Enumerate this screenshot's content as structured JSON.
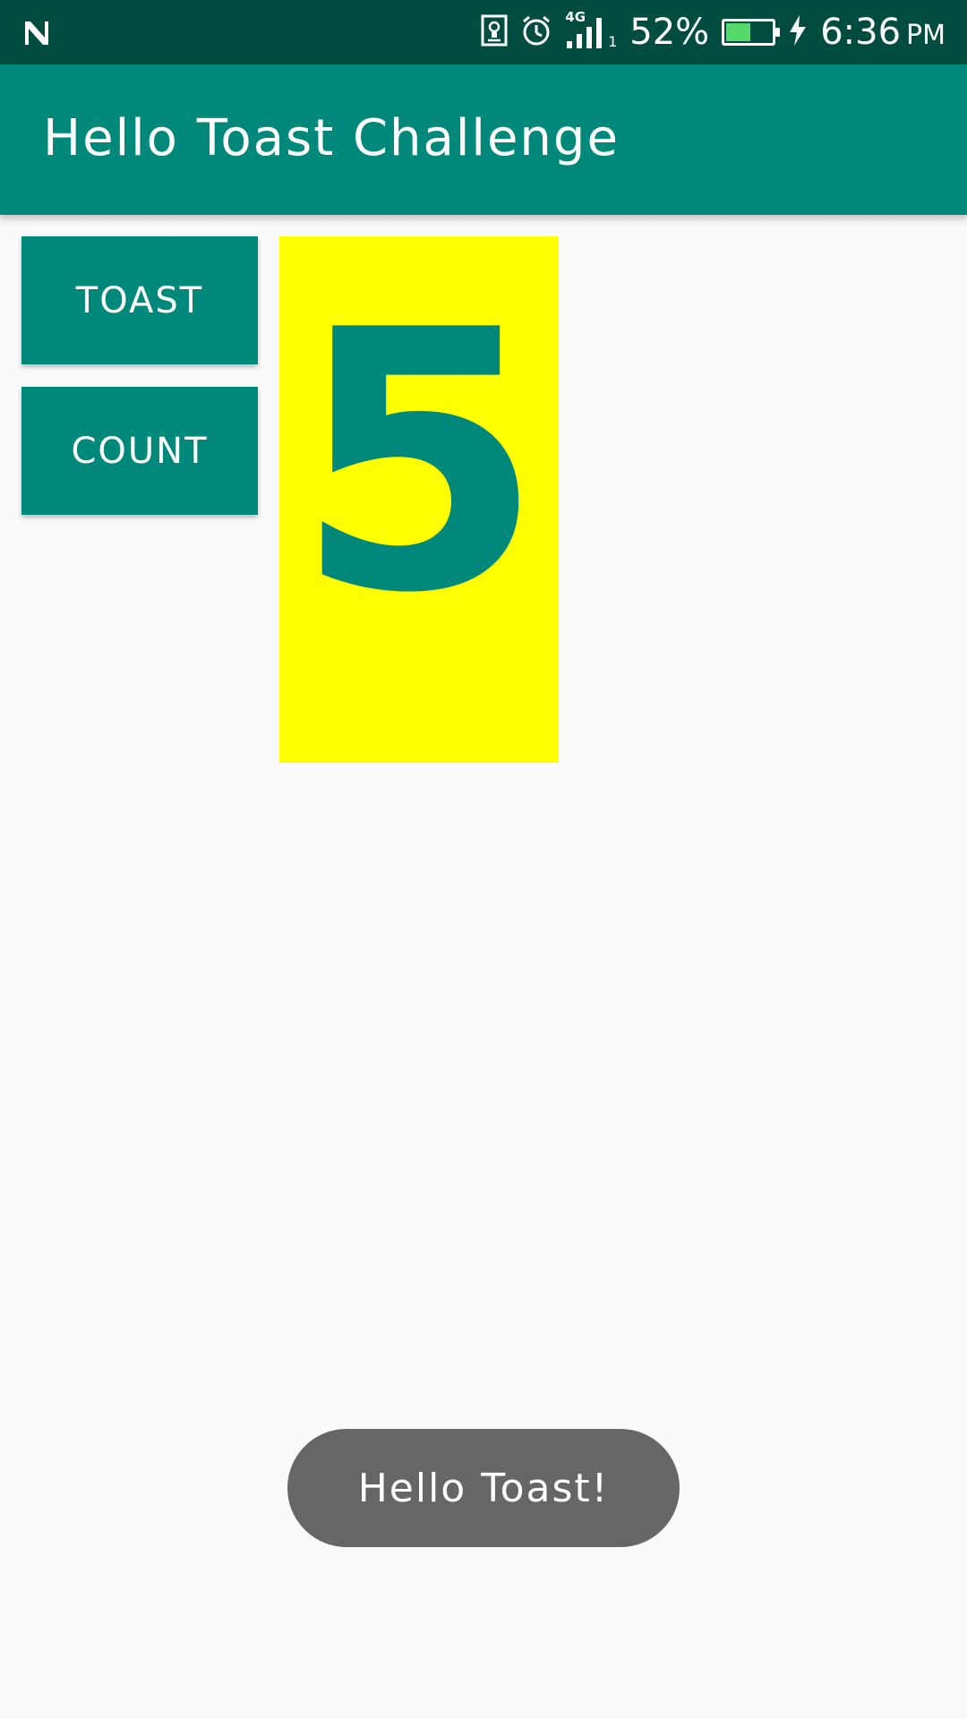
{
  "status_bar": {
    "battery_percent": "52%",
    "battery_level": 0.52,
    "time": "6:36",
    "time_suffix": "PM",
    "network": "4G",
    "sim_slot": "1",
    "icons": [
      "notification-n-icon",
      "screenshot-icon",
      "alarm-icon",
      "signal-icon",
      "battery-icon",
      "charging-icon"
    ]
  },
  "app_bar": {
    "title": "Hello Toast Challenge"
  },
  "buttons": {
    "toast_label": "TOAST",
    "count_label": "COUNT"
  },
  "counter": {
    "value": "5"
  },
  "toast": {
    "message": "Hello Toast!"
  },
  "colors": {
    "status_bar": "#004d40",
    "primary": "#00897b",
    "counter_background": "#ffff00",
    "toast_background": "#666666",
    "page_background": "#fafafa"
  }
}
